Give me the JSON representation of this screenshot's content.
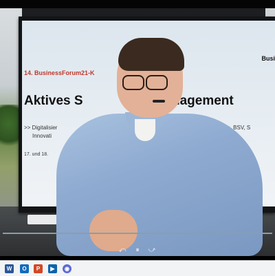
{
  "slide": {
    "brand": "Busi",
    "event": "14. BusinessForum21-K",
    "headline_part1": "Aktives S",
    "headline_part2": "nagement",
    "subtitle_line1": ">> Digitalisier",
    "subtitle_line2": "Innovati",
    "subtitle_right": "eschaden, BSV, S",
    "date": "17. und 18."
  },
  "player": {
    "rewind_label": "⤺",
    "pause_label": "⏸",
    "forward_label": "⤻"
  },
  "taskbar": {
    "apps": [
      {
        "name": "word",
        "label": "W",
        "color": "#2b579a"
      },
      {
        "name": "outlook",
        "label": "O",
        "color": "#0f6cbd"
      },
      {
        "name": "powerpoint",
        "label": "P",
        "color": "#d24726"
      },
      {
        "name": "media-player",
        "label": "▶",
        "color": "#0a64ad"
      },
      {
        "name": "browser",
        "label": "◉",
        "color": "#5b6bd8"
      }
    ]
  }
}
